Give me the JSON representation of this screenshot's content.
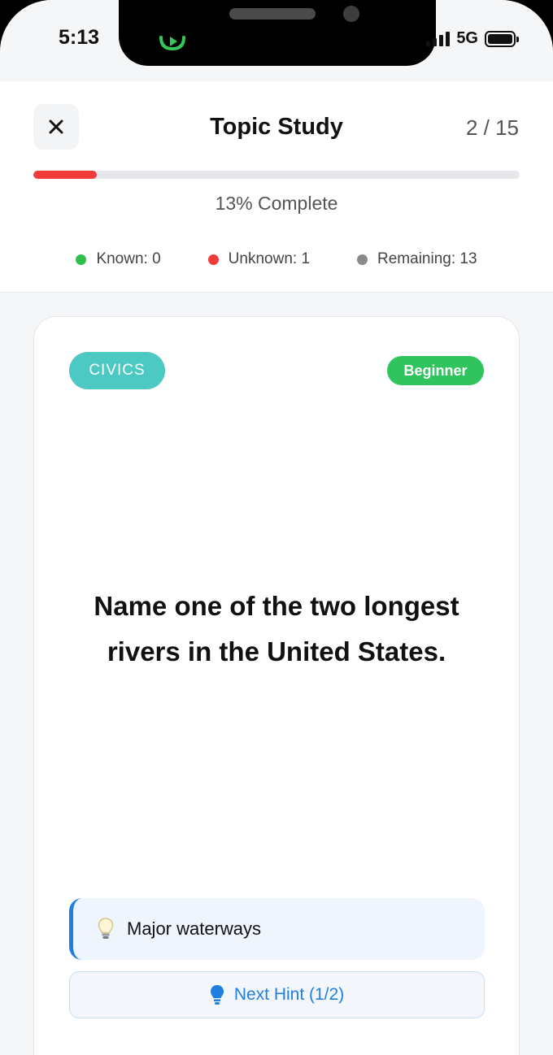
{
  "status_bar": {
    "time": "5:13",
    "network": "5G",
    "icons": [
      "screen-recording-icon",
      "signal-icon",
      "battery-icon"
    ]
  },
  "header": {
    "close_icon": "close-icon",
    "title": "Topic Study",
    "counter": "2 / 15",
    "progress": {
      "fraction": 0.13,
      "label": "13% Complete",
      "color": "#f03b3b"
    },
    "stats": [
      {
        "label": "Known: 0",
        "color": "#2fbf4f"
      },
      {
        "label": "Unknown: 1",
        "color": "#f03b3b"
      },
      {
        "label": "Remaining: 13",
        "color": "#8a8a8a"
      }
    ]
  },
  "card": {
    "topic": "CIVICS",
    "topic_color": "#4dc9c3",
    "level": "Beginner",
    "level_color": "#2fc45e",
    "question": "Name one of the two longest rivers in the United States.",
    "hint": {
      "icon": "lightbulb-icon",
      "text": "Major waterways"
    },
    "next_hint": {
      "icon": "lightbulb-icon",
      "label": "Next Hint (1/2)"
    }
  }
}
